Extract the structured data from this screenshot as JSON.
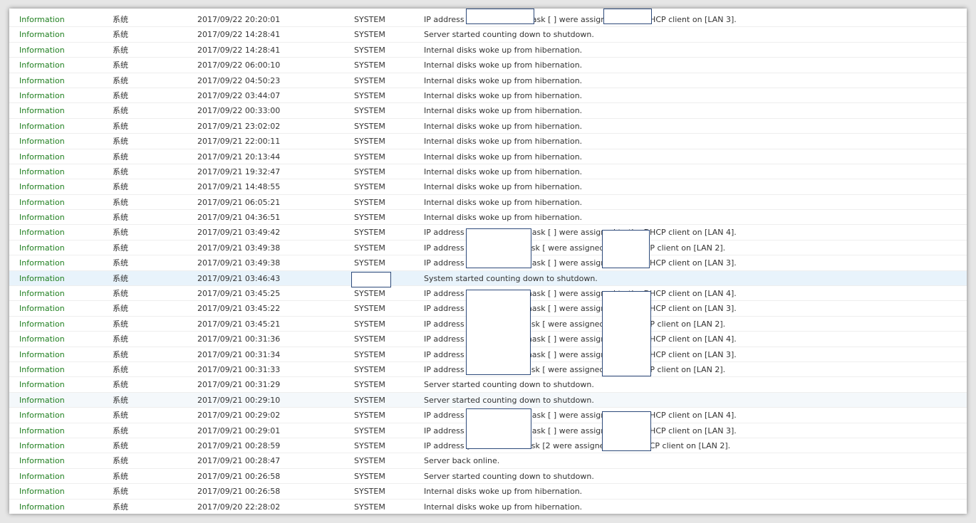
{
  "log": {
    "rows": [
      {
        "level": "Information",
        "category": "系统",
        "time": "2017/09/22 20:20:01",
        "user": "SYSTEM",
        "event": "IP address [               ] and subnet mask [               ] were assigned to the DHCP client on [LAN 3]."
      },
      {
        "level": "Information",
        "category": "系统",
        "time": "2017/09/22 14:28:41",
        "user": "SYSTEM",
        "event": "Server started counting down to shutdown."
      },
      {
        "level": "Information",
        "category": "系统",
        "time": "2017/09/22 14:28:41",
        "user": "SYSTEM",
        "event": "Internal disks woke up from hibernation."
      },
      {
        "level": "Information",
        "category": "系统",
        "time": "2017/09/22 06:00:10",
        "user": "SYSTEM",
        "event": "Internal disks woke up from hibernation."
      },
      {
        "level": "Information",
        "category": "系统",
        "time": "2017/09/22 04:50:23",
        "user": "SYSTEM",
        "event": "Internal disks woke up from hibernation."
      },
      {
        "level": "Information",
        "category": "系统",
        "time": "2017/09/22 03:44:07",
        "user": "SYSTEM",
        "event": "Internal disks woke up from hibernation."
      },
      {
        "level": "Information",
        "category": "系统",
        "time": "2017/09/22 00:33:00",
        "user": "SYSTEM",
        "event": "Internal disks woke up from hibernation."
      },
      {
        "level": "Information",
        "category": "系统",
        "time": "2017/09/21 23:02:02",
        "user": "SYSTEM",
        "event": "Internal disks woke up from hibernation."
      },
      {
        "level": "Information",
        "category": "系统",
        "time": "2017/09/21 22:00:11",
        "user": "SYSTEM",
        "event": "Internal disks woke up from hibernation."
      },
      {
        "level": "Information",
        "category": "系统",
        "time": "2017/09/21 20:13:44",
        "user": "SYSTEM",
        "event": "Internal disks woke up from hibernation."
      },
      {
        "level": "Information",
        "category": "系统",
        "time": "2017/09/21 19:32:47",
        "user": "SYSTEM",
        "event": "Internal disks woke up from hibernation."
      },
      {
        "level": "Information",
        "category": "系统",
        "time": "2017/09/21 14:48:55",
        "user": "SYSTEM",
        "event": "Internal disks woke up from hibernation."
      },
      {
        "level": "Information",
        "category": "系统",
        "time": "2017/09/21 06:05:21",
        "user": "SYSTEM",
        "event": "Internal disks woke up from hibernation."
      },
      {
        "level": "Information",
        "category": "系统",
        "time": "2017/09/21 04:36:51",
        "user": "SYSTEM",
        "event": "Internal disks woke up from hibernation."
      },
      {
        "level": "Information",
        "category": "系统",
        "time": "2017/09/21 03:49:42",
        "user": "SYSTEM",
        "event": "IP address [               ] and subnet mask [               ] were assigned to the DHCP client on [LAN 4]."
      },
      {
        "level": "Information",
        "category": "系统",
        "time": "2017/09/21 03:49:38",
        "user": "SYSTEM",
        "event": "IP address [             and subnet mask [               were assigned to the DHCP client on [LAN 2]."
      },
      {
        "level": "Information",
        "category": "系统",
        "time": "2017/09/21 03:49:38",
        "user": "SYSTEM",
        "event": "IP address [               ] and subnet mask [               ] were assigned to the DHCP client on [LAN 3]."
      },
      {
        "level": "Information",
        "category": "系统",
        "time": "2017/09/21 03:46:43",
        "user": "",
        "event": "System started counting down to shutdown."
      },
      {
        "level": "Information",
        "category": "系统",
        "time": "2017/09/21 03:45:25",
        "user": "SYSTEM",
        "event": "IP address [               ] and subnet mask [               ] were assigned to the DHCP client on [LAN 4]."
      },
      {
        "level": "Information",
        "category": "系统",
        "time": "2017/09/21 03:45:22",
        "user": "SYSTEM",
        "event": "IP address [               ] and subnet mask [               ] were assigned to the DHCP client on [LAN 3]."
      },
      {
        "level": "Information",
        "category": "系统",
        "time": "2017/09/21 03:45:21",
        "user": "SYSTEM",
        "event": "IP address [             and subnet mask [               were assigned to the DHCP client on [LAN 2]."
      },
      {
        "level": "Information",
        "category": "系统",
        "time": "2017/09/21 00:31:36",
        "user": "SYSTEM",
        "event": "IP address [               ] and subnet mask [               ] were assigned to the DHCP client on [LAN 4]."
      },
      {
        "level": "Information",
        "category": "系统",
        "time": "2017/09/21 00:31:34",
        "user": "SYSTEM",
        "event": "IP address [               ] and subnet mask [               ] were assigned to the DHCP client on [LAN 3]."
      },
      {
        "level": "Information",
        "category": "系统",
        "time": "2017/09/21 00:31:33",
        "user": "SYSTEM",
        "event": "IP address [             and subnet mask [               were assigned to the DHCP client on [LAN 2]."
      },
      {
        "level": "Information",
        "category": "系统",
        "time": "2017/09/21 00:31:29",
        "user": "SYSTEM",
        "event": "Server started counting down to shutdown."
      },
      {
        "level": "Information",
        "category": "系统",
        "time": "2017/09/21 00:29:10",
        "user": "SYSTEM",
        "event": "Server started counting down to shutdown."
      },
      {
        "level": "Information",
        "category": "系统",
        "time": "2017/09/21 00:29:02",
        "user": "SYSTEM",
        "event": "IP address [               ] and subnet mask [               ] were assigned to the DHCP client on [LAN 4]."
      },
      {
        "level": "Information",
        "category": "系统",
        "time": "2017/09/21 00:29:01",
        "user": "SYSTEM",
        "event": "IP address [               ] and subnet mask [               ] were assigned to the DHCP client on [LAN 3]."
      },
      {
        "level": "Information",
        "category": "系统",
        "time": "2017/09/21 00:28:59",
        "user": "SYSTEM",
        "event": "IP address [             and subnet mask [2              were assigned to the DHCP client on [LAN 2]."
      },
      {
        "level": "Information",
        "category": "系统",
        "time": "2017/09/21 00:28:47",
        "user": "SYSTEM",
        "event": "Server back online."
      },
      {
        "level": "Information",
        "category": "系统",
        "time": "2017/09/21 00:26:58",
        "user": "SYSTEM",
        "event": "Server started counting down to shutdown."
      },
      {
        "level": "Information",
        "category": "系统",
        "time": "2017/09/21 00:26:58",
        "user": "SYSTEM",
        "event": "Internal disks woke up from hibernation."
      },
      {
        "level": "Information",
        "category": "系统",
        "time": "2017/09/20 22:28:02",
        "user": "SYSTEM",
        "event": "Internal disks woke up from hibernation."
      }
    ]
  },
  "colors": {
    "level_text": "#1f7f1f",
    "selected_row": "#e8f3fb",
    "redaction_border": "#2d4a7a"
  }
}
